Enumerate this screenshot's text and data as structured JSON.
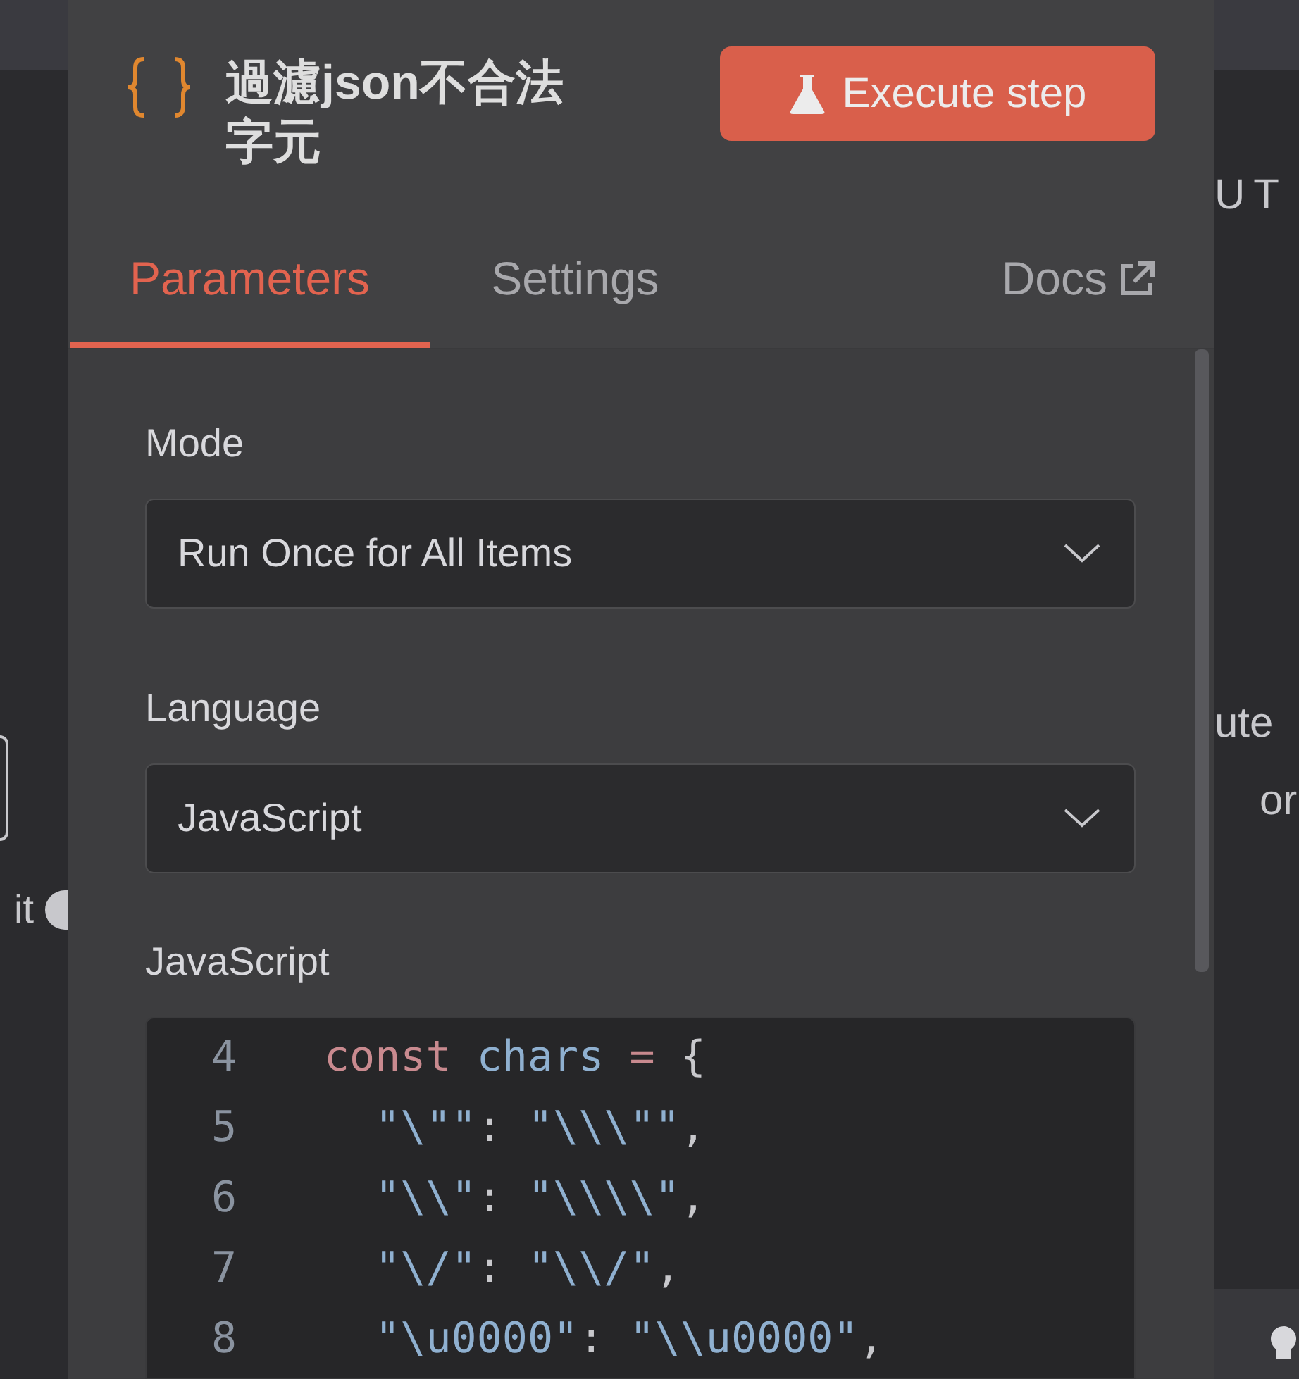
{
  "background": {
    "left_texts": [
      "it"
    ],
    "right_texts": [
      "UT",
      "ute",
      "or"
    ]
  },
  "node": {
    "title": "過濾json不合法字元",
    "execute_button": "Execute step"
  },
  "tabs": [
    {
      "label": "Parameters",
      "selected": true
    },
    {
      "label": "Settings",
      "selected": false
    },
    {
      "label": "Docs",
      "selected": false,
      "kind": "external"
    }
  ],
  "fields": [
    {
      "label": "Mode",
      "value": "Run Once for All Items"
    },
    {
      "label": "Language",
      "value": "JavaScript"
    }
  ],
  "code_editor": {
    "label": "JavaScript",
    "lines": [
      {
        "number": "4",
        "tokens": [
          {
            "kind": "keyword",
            "text": "const"
          },
          {
            "kind": "variable",
            "text": " chars"
          },
          {
            "kind": "operator",
            "text": " ="
          },
          {
            "kind": "punct",
            "text": " {"
          }
        ]
      },
      {
        "number": "5",
        "tokens": [
          {
            "kind": "string",
            "text": "  \"\\\"\""
          },
          {
            "kind": "punct",
            "text": ": "
          },
          {
            "kind": "string",
            "text": "\"\\\\\\\"\""
          },
          {
            "kind": "punct",
            "text": ","
          }
        ]
      },
      {
        "number": "6",
        "tokens": [
          {
            "kind": "string",
            "text": "  \"\\\\\""
          },
          {
            "kind": "punct",
            "text": ": "
          },
          {
            "kind": "string",
            "text": "\"\\\\\\\\\""
          },
          {
            "kind": "punct",
            "text": ","
          }
        ]
      },
      {
        "number": "7",
        "tokens": [
          {
            "kind": "string",
            "text": "  \"\\/\""
          },
          {
            "kind": "punct",
            "text": ": "
          },
          {
            "kind": "string",
            "text": "\"\\\\/\""
          },
          {
            "kind": "punct",
            "text": ","
          }
        ]
      },
      {
        "number": "8",
        "tokens": [
          {
            "kind": "string",
            "text": "  \"\\u0000\""
          },
          {
            "kind": "punct",
            "text": ": "
          },
          {
            "kind": "string",
            "text": "\"\\\\u0000\""
          },
          {
            "kind": "punct",
            "text": ","
          }
        ]
      }
    ]
  }
}
